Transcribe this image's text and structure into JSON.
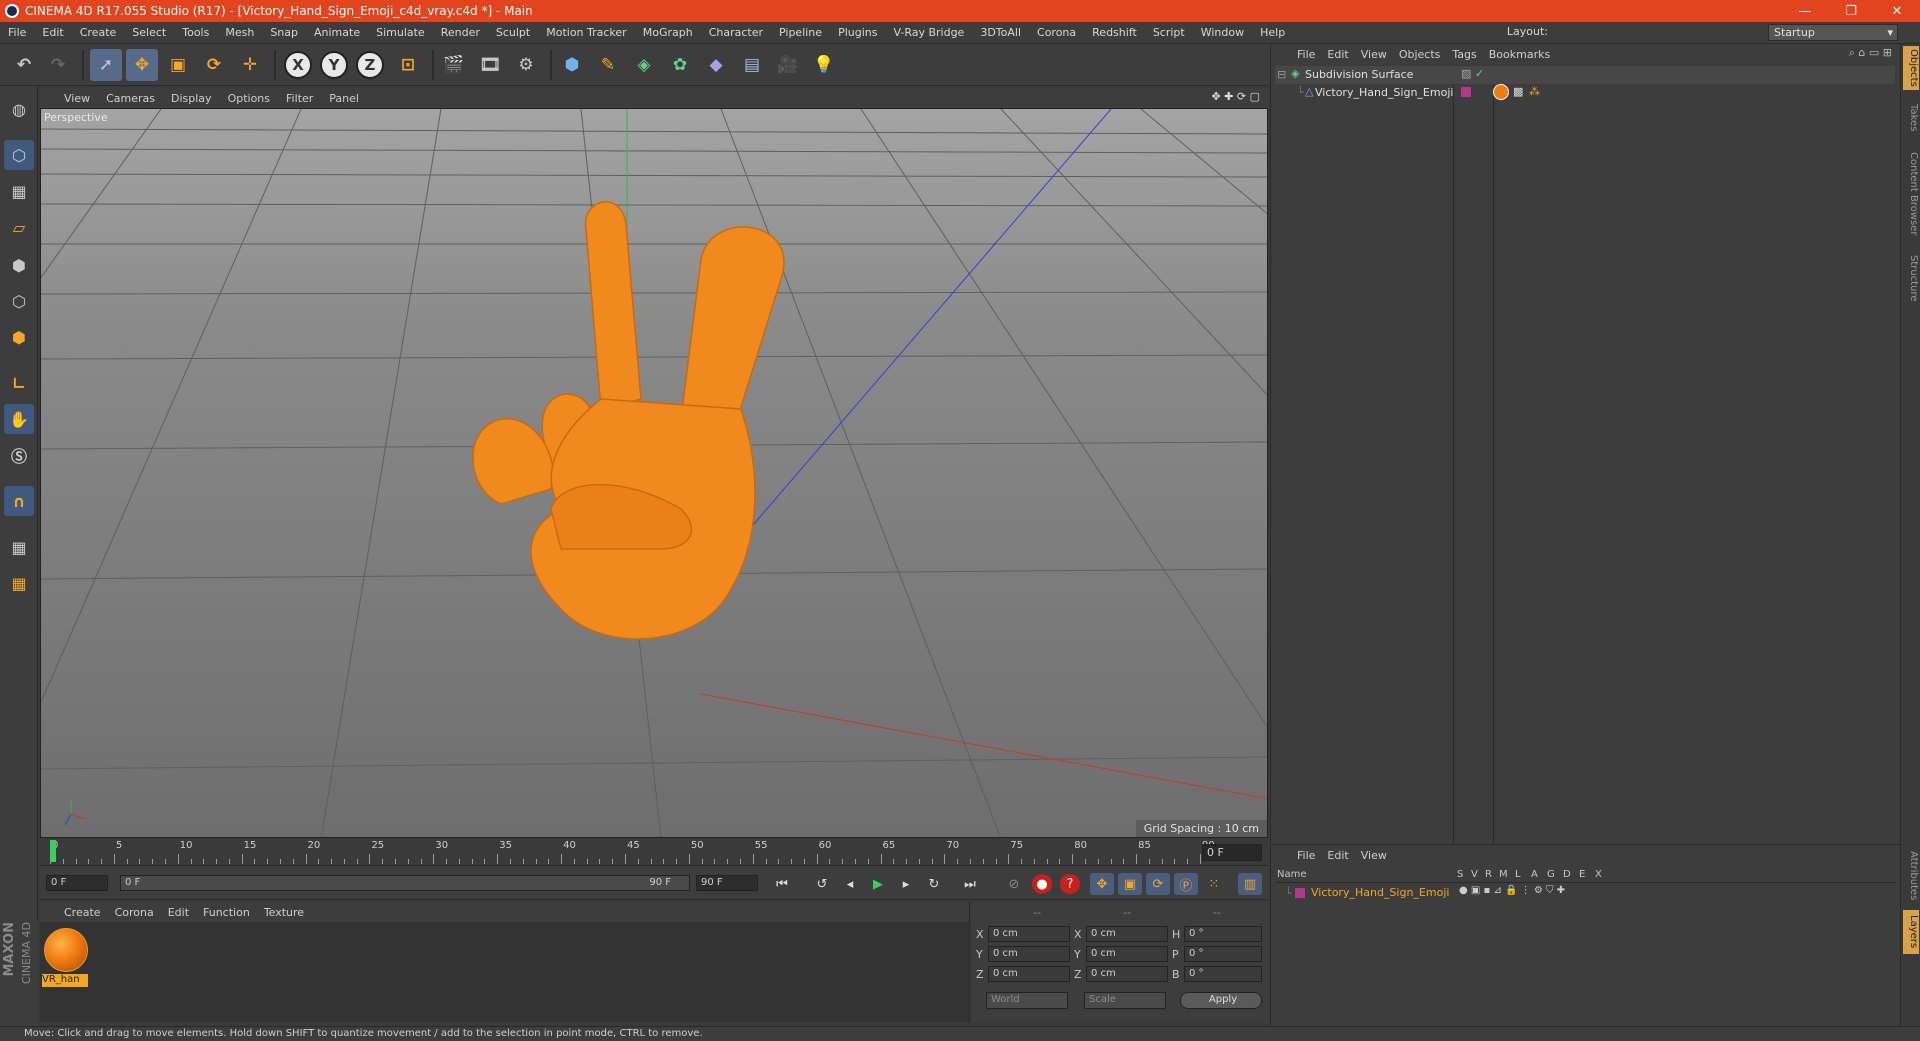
{
  "window": {
    "title": "CINEMA 4D R17.055 Studio (R17) - [Victory_Hand_Sign_Emoji_c4d_vray.c4d *] - Main",
    "controls": [
      "—",
      "❐",
      "✕"
    ]
  },
  "menubar": {
    "items": [
      "File",
      "Edit",
      "Create",
      "Select",
      "Tools",
      "Mesh",
      "Snap",
      "Animate",
      "Simulate",
      "Render",
      "Sculpt",
      "Motion Tracker",
      "MoGraph",
      "Character",
      "Pipeline",
      "Plugins",
      "V-Ray Bridge",
      "3DToAll",
      "Corona",
      "Redshift",
      "Script",
      "Window",
      "Help"
    ],
    "layout_label": "Layout:",
    "layout_value": "Startup"
  },
  "toolbar": {
    "axis_x": "X",
    "axis_y": "Y",
    "axis_z": "Z"
  },
  "viewport": {
    "menu": [
      "View",
      "Cameras",
      "Display",
      "Options",
      "Filter",
      "Panel"
    ],
    "label": "Perspective",
    "grid_spacing": "Grid Spacing : 10 cm"
  },
  "timeline": {
    "ticks": [
      "0",
      "5",
      "10",
      "15",
      "20",
      "25",
      "30",
      "35",
      "40",
      "45",
      "50",
      "55",
      "60",
      "65",
      "70",
      "75",
      "80",
      "85",
      "90"
    ],
    "current_frame": "0 F",
    "start_field": "0 F",
    "range_start": "0 F",
    "range_end": "90 F",
    "end_field": "90 F"
  },
  "material_manager": {
    "menu": [
      "Create",
      "Corona",
      "Edit",
      "Function",
      "Texture"
    ],
    "materials": [
      {
        "name": "VR_han"
      }
    ]
  },
  "coordinates": {
    "header": [
      "--",
      "--",
      "--"
    ],
    "rows": [
      {
        "a": "X",
        "av": "0 cm",
        "b": "X",
        "bv": "0 cm",
        "c": "H",
        "cv": "0 °"
      },
      {
        "a": "Y",
        "av": "0 cm",
        "b": "Y",
        "bv": "0 cm",
        "c": "P",
        "cv": "0 °"
      },
      {
        "a": "Z",
        "av": "0 cm",
        "b": "Z",
        "bv": "0 cm",
        "c": "B",
        "cv": "0 °"
      }
    ],
    "world": "World",
    "scale": "Scale",
    "apply": "Apply"
  },
  "object_manager": {
    "menu": [
      "File",
      "Edit",
      "View",
      "Objects",
      "Tags",
      "Bookmarks"
    ],
    "objects": [
      {
        "name": "Subdivision Surface"
      },
      {
        "name": "Victory_Hand_Sign_Emoji"
      }
    ]
  },
  "attribute_manager": {
    "menu": [
      "File",
      "Edit",
      "View"
    ],
    "columns": [
      "Name",
      "S",
      "V",
      "R",
      "M",
      "L",
      "A",
      "G",
      "D",
      "E",
      "X"
    ],
    "row_name": "Victory_Hand_Sign_Emoji"
  },
  "right_tabs": [
    "Objects",
    "Takes",
    "Content Browser",
    "Structure",
    "Attributes",
    "Layers"
  ],
  "branding": {
    "maxon": "MAXON",
    "cinema": "CINEMA 4D"
  },
  "status": "Move: Click and drag to move elements. Hold down SHIFT to quantize movement / add to the selection in point mode, CTRL to remove.",
  "colors": {
    "title_bar": "#e2441d",
    "hand": "#f08a1e",
    "accent_blue": "#586a8a"
  }
}
